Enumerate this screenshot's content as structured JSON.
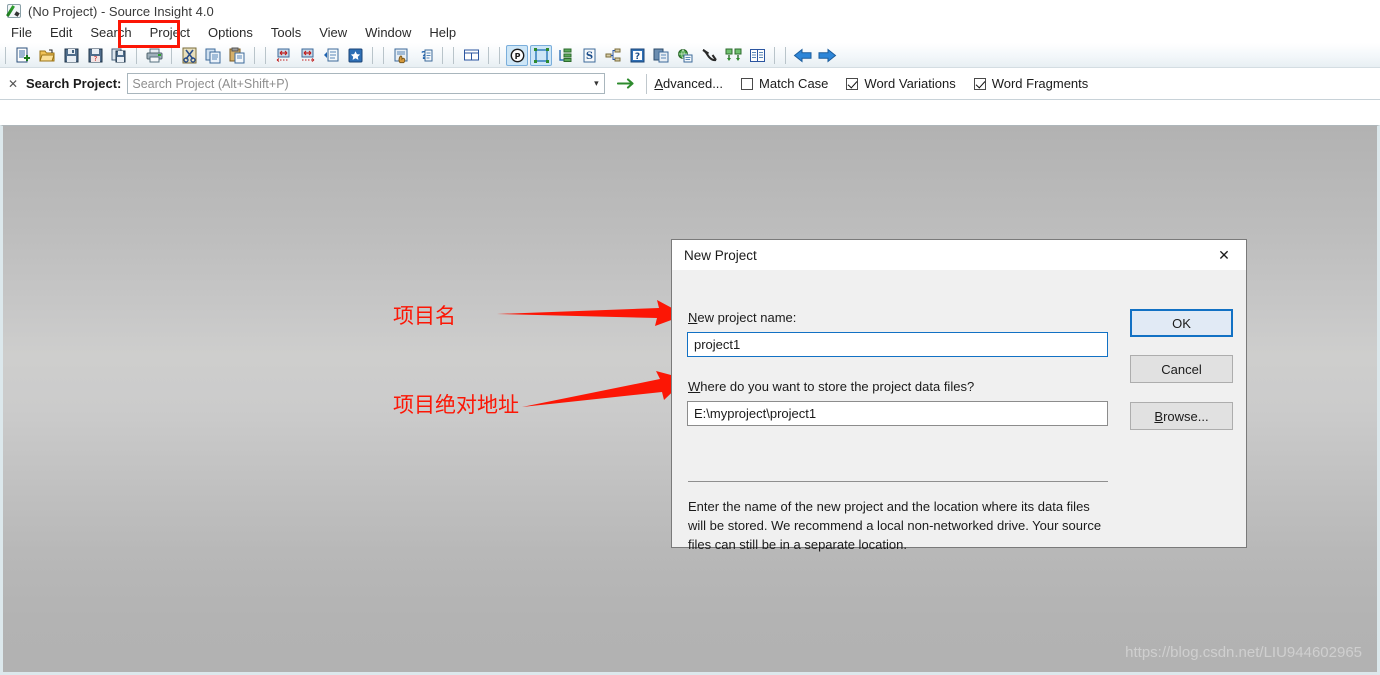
{
  "window": {
    "title": "(No Project) - Source Insight 4.0",
    "logo_icon": "source-insight-logo-icon"
  },
  "menubar": {
    "items": [
      {
        "label": "File"
      },
      {
        "label": "Edit"
      },
      {
        "label": "Search"
      },
      {
        "label": "Project",
        "highlighted": true
      },
      {
        "label": "Options"
      },
      {
        "label": "Tools"
      },
      {
        "label": "View"
      },
      {
        "label": "Window"
      },
      {
        "label": "Help"
      }
    ],
    "highlight_color": "#fc1605"
  },
  "toolbar": {
    "buttons": [
      {
        "icon": "new-file-icon"
      },
      {
        "icon": "open-folder-icon"
      },
      {
        "icon": "save-icon"
      },
      {
        "icon": "save-all-icon"
      },
      {
        "icon": "copy-file-icon"
      },
      {
        "icon": "print-icon"
      },
      {
        "icon": "cut-scissors-icon"
      },
      {
        "icon": "copy-icon"
      },
      {
        "icon": "paste-icon"
      },
      {
        "icon": "indent-left-icon"
      },
      {
        "icon": "indent-right-icon"
      },
      {
        "icon": "insert-block-icon"
      },
      {
        "icon": "bookmark-star-icon"
      },
      {
        "icon": "highlight-hand-icon"
      },
      {
        "icon": "help-context-icon"
      },
      {
        "icon": "split-window-icon"
      },
      {
        "icon": "project-symbol-icon",
        "active": true
      },
      {
        "icon": "symbol-window-icon",
        "active": true
      },
      {
        "icon": "outline-icon"
      },
      {
        "icon": "source-symbol-icon"
      },
      {
        "icon": "relation-window-icon"
      },
      {
        "icon": "context-help-icon"
      },
      {
        "icon": "add-file-icon"
      },
      {
        "icon": "browse-globe-icon"
      },
      {
        "icon": "smart-rename-icon"
      },
      {
        "icon": "sync-files-icon"
      },
      {
        "icon": "file-list-icon"
      },
      {
        "icon": "back-arrow-icon"
      },
      {
        "icon": "forward-arrow-icon"
      }
    ]
  },
  "search_bar": {
    "close_icon": "close-x-icon",
    "label": "Search Project:",
    "input_value": "",
    "input_placeholder": "Search Project (Alt+Shift+P)",
    "dropdown_icon": "chevron-down-icon",
    "go_icon": "arrow-right-icon",
    "advanced_label": "Advanced...",
    "advanced_accel": "A",
    "checkboxes": [
      {
        "label": "Match Case",
        "checked": false
      },
      {
        "label": "Word Variations",
        "checked": true
      },
      {
        "label": "Word Fragments",
        "checked": true
      }
    ]
  },
  "annotations": [
    {
      "text": "项目名",
      "color": "#fc1605"
    },
    {
      "text": "项目绝对地址",
      "color": "#fc1605"
    }
  ],
  "dialog": {
    "title": "New Project",
    "close_icon": "close-x-icon",
    "name_label_accel": "N",
    "name_label_rest": "ew project name:",
    "name_value": "project1",
    "path_label_accel": "W",
    "path_label_rest": "here do you want to store the project data files?",
    "path_value": "E:\\myproject\\project1",
    "buttons": {
      "ok": "OK",
      "cancel": "Cancel",
      "browse_accel": "B",
      "browse_rest": "rowse..."
    },
    "description": "Enter the name of the new project and the location where its data files will be stored. We recommend a local non-networked drive. Your source files can still be in a separate location.",
    "focus_color": "#1271c4"
  },
  "watermark": {
    "text": "https://blog.csdn.net/LIU944602965"
  }
}
